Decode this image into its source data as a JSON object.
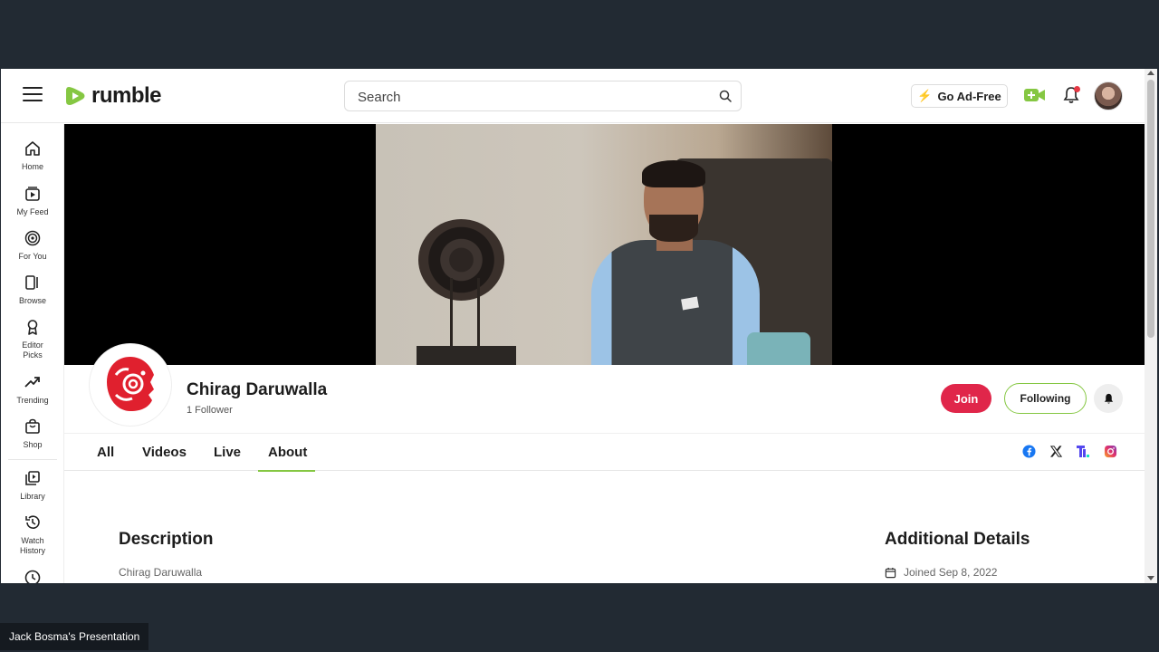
{
  "header": {
    "logo_text": "rumble",
    "search_placeholder": "Search",
    "ad_free_label": "Go Ad-Free"
  },
  "sidebar": {
    "items": [
      {
        "label": "Home",
        "icon": "home-icon"
      },
      {
        "label": "My Feed",
        "icon": "feed-icon"
      },
      {
        "label": "For You",
        "icon": "target-icon"
      },
      {
        "label": "Browse",
        "icon": "browse-icon"
      },
      {
        "label": "Editor Picks",
        "icon": "award-icon"
      },
      {
        "label": "Trending",
        "icon": "trending-icon"
      },
      {
        "label": "Shop",
        "icon": "shop-icon"
      },
      {
        "label": "Library",
        "icon": "library-icon"
      },
      {
        "label": "Watch History",
        "icon": "history-icon"
      }
    ]
  },
  "channel": {
    "name": "Chirag Daruwalla",
    "followers": "1 Follower",
    "join_label": "Join",
    "following_label": "Following"
  },
  "tabs": {
    "items": [
      "All",
      "Videos",
      "Live",
      "About"
    ],
    "active": "About"
  },
  "socials": [
    "facebook-icon",
    "x-icon",
    "truth-social-icon",
    "instagram-icon"
  ],
  "about": {
    "description_title": "Description",
    "description_text": "Chirag Daruwalla",
    "details_title": "Additional Details",
    "joined": "Joined Sep 8, 2022"
  },
  "presenter_label": "Jack Bosma's Presentation",
  "colors": {
    "brand_green": "#85c742",
    "join_red": "#e0264a",
    "background": "#222a33"
  }
}
